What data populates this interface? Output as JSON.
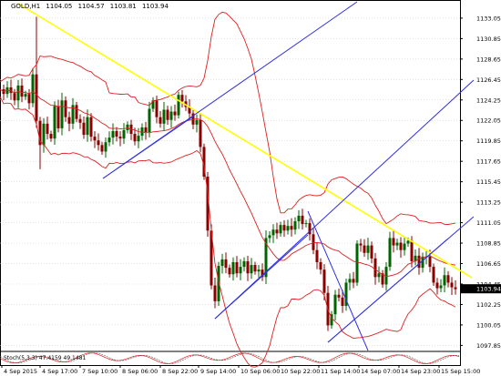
{
  "header": {
    "symbol": "GOLD,H1",
    "ohlc": [
      "1104.05",
      "1104.57",
      "1103.81",
      "1103.94"
    ]
  },
  "oscillator": {
    "label": "Stoch(5,3,3) 47.4159 49.1481"
  },
  "colors": {
    "background": "#ffffff",
    "grid": "#c8c8c8",
    "candle_up": "#006400",
    "candle_down": "#8b0000",
    "bollinger": "#e02020",
    "trendline": "#ffff00",
    "channel": "#3030e0",
    "current_price_bg": "#000000"
  },
  "chart_data": {
    "type": "candlestick",
    "symbol": "GOLD,H1",
    "y_ticks": [
      "1133.05",
      "1130.85",
      "1128.65",
      "1126.45",
      "1124.25",
      "1122.05",
      "1119.85",
      "1117.65",
      "1115.45",
      "1113.25",
      "1111.05",
      "1108.85",
      "1106.65",
      "1104.45",
      "1102.25",
      "1100.05",
      "1097.85"
    ],
    "ylim": [
      1097.3,
      1135.0
    ],
    "current_price": "1103.94",
    "x_ticks": [
      "4 Sep 2015",
      "4 Sep 17:00",
      "7 Sep 10:00",
      "8 Sep 06:00",
      "8 Sep 22:00",
      "9 Sep 14:00",
      "10 Sep 06:00",
      "10 Sep 22:00",
      "11 Sep 14:00",
      "14 Sep 07:00",
      "14 Sep 23:00",
      "15 Sep 15:00"
    ],
    "close_path": [
      [
        0,
        1125.4
      ],
      [
        4,
        1124.9
      ],
      [
        8,
        1125.6
      ],
      [
        12,
        1125.0
      ],
      [
        16,
        1124.2
      ],
      [
        20,
        1125.8
      ],
      [
        24,
        1124.6
      ],
      [
        28,
        1124.9
      ],
      [
        32,
        1123.9
      ],
      [
        36,
        1127.0
      ],
      [
        40,
        1122.0
      ],
      [
        44,
        1119.4
      ],
      [
        48,
        1121.7
      ],
      [
        52,
        1120.6
      ],
      [
        56,
        1120.1
      ],
      [
        60,
        1123.6
      ],
      [
        64,
        1121.2
      ],
      [
        68,
        1124.2
      ],
      [
        72,
        1122.4
      ],
      [
        76,
        1121.7
      ],
      [
        80,
        1123.7
      ],
      [
        84,
        1122.2
      ],
      [
        88,
        1121.8
      ],
      [
        92,
        1120.5
      ],
      [
        96,
        1122.4
      ],
      [
        100,
        1120.3
      ],
      [
        104,
        1119.9
      ],
      [
        108,
        1119.4
      ],
      [
        112,
        1118.7
      ],
      [
        116,
        1119.7
      ],
      [
        120,
        1120.2
      ],
      [
        124,
        1120.9
      ],
      [
        128,
        1120.3
      ],
      [
        132,
        1120.1
      ],
      [
        136,
        1121.0
      ],
      [
        140,
        1121.6
      ],
      [
        144,
        1120.6
      ],
      [
        148,
        1119.8
      ],
      [
        152,
        1120.4
      ],
      [
        156,
        1121.3
      ],
      [
        160,
        1120.8
      ],
      [
        164,
        1123.3
      ],
      [
        168,
        1124.2
      ],
      [
        172,
        1122.4
      ],
      [
        176,
        1121.7
      ],
      [
        180,
        1123.2
      ],
      [
        184,
        1122.1
      ],
      [
        188,
        1123.0
      ],
      [
        192,
        1122.6
      ],
      [
        196,
        1124.8
      ],
      [
        200,
        1124.1
      ],
      [
        204,
        1123.5
      ],
      [
        208,
        1122.8
      ],
      [
        212,
        1121.6
      ],
      [
        216,
        1122.1
      ],
      [
        220,
        1119.2
      ],
      [
        224,
        1116.0
      ],
      [
        228,
        1110.2
      ],
      [
        232,
        1104.3
      ],
      [
        236,
        1102.6
      ],
      [
        240,
        1106.4
      ],
      [
        244,
        1107.1
      ],
      [
        248,
        1106.2
      ],
      [
        252,
        1105.5
      ],
      [
        256,
        1106.8
      ],
      [
        260,
        1105.6
      ],
      [
        264,
        1106.3
      ],
      [
        268,
        1106.9
      ],
      [
        272,
        1105.6
      ],
      [
        276,
        1106.5
      ],
      [
        280,
        1105.8
      ],
      [
        284,
        1106.0
      ],
      [
        288,
        1105.2
      ],
      [
        292,
        1109.4
      ],
      [
        296,
        1109.7
      ],
      [
        300,
        1110.3
      ],
      [
        304,
        1109.9
      ],
      [
        308,
        1110.8
      ],
      [
        312,
        1110.2
      ],
      [
        316,
        1110.7
      ],
      [
        320,
        1110.3
      ],
      [
        324,
        1111.2
      ],
      [
        328,
        1111.8
      ],
      [
        332,
        1110.9
      ],
      [
        336,
        1111.0
      ],
      [
        340,
        1109.8
      ],
      [
        344,
        1108.1
      ],
      [
        348,
        1106.8
      ],
      [
        352,
        1106.0
      ],
      [
        356,
        1103.5
      ],
      [
        360,
        1100.0
      ],
      [
        364,
        1101.2
      ],
      [
        368,
        1103.3
      ],
      [
        372,
        1103.0
      ],
      [
        376,
        1102.1
      ],
      [
        380,
        1104.6
      ],
      [
        384,
        1105.0
      ],
      [
        388,
        1104.6
      ],
      [
        392,
        1108.8
      ],
      [
        396,
        1108.6
      ],
      [
        400,
        1107.8
      ],
      [
        404,
        1108.6
      ],
      [
        408,
        1107.2
      ],
      [
        412,
        1105.2
      ],
      [
        416,
        1105.6
      ],
      [
        420,
        1104.4
      ],
      [
        424,
        1106.3
      ],
      [
        428,
        1109.4
      ],
      [
        432,
        1108.6
      ],
      [
        436,
        1108.9
      ],
      [
        440,
        1108.1
      ],
      [
        444,
        1108.8
      ],
      [
        448,
        1109.1
      ],
      [
        452,
        1106.9
      ],
      [
        456,
        1107.5
      ],
      [
        460,
        1106.2
      ],
      [
        464,
        1107.4
      ],
      [
        468,
        1107.4
      ],
      [
        472,
        1106.3
      ],
      [
        476,
        1104.6
      ],
      [
        480,
        1104.0
      ],
      [
        484,
        1104.3
      ],
      [
        488,
        1105.4
      ],
      [
        492,
        1104.6
      ],
      [
        496,
        1104.1
      ],
      [
        500,
        1103.9
      ]
    ]
  }
}
